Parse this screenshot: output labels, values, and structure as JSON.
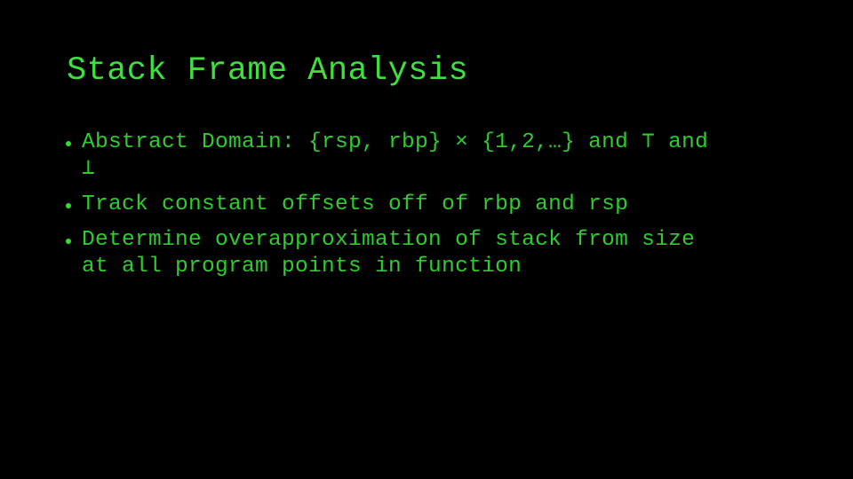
{
  "slide": {
    "title": "Stack Frame Analysis",
    "text_color": "#33dd33",
    "background": "#000000"
  },
  "bullets": [
    {
      "lines": [
        "Abstract Domain: {rsp, rbp} × {1,2,…} and ⊤ and",
        "⊥"
      ]
    },
    {
      "lines": [
        "Track constant offsets off of rbp and rsp"
      ]
    },
    {
      "lines": [
        "Determine overapproximation of stack from size",
        "at all program points in function"
      ]
    }
  ]
}
